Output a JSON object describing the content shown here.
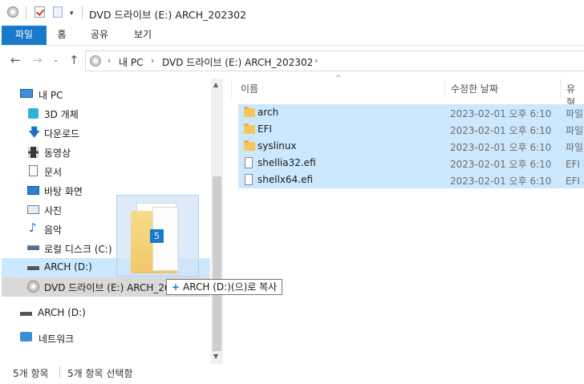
{
  "window": {
    "title": "DVD 드라이브 (E:) ARCH_202302"
  },
  "ribbon": {
    "tabs": [
      "파일",
      "홈",
      "공유",
      "보기"
    ]
  },
  "address": {
    "crumbs": [
      "내 PC",
      "DVD 드라이브 (E:) ARCH_202302"
    ]
  },
  "nav": {
    "items": [
      {
        "label": "내 PC",
        "icon": "computer-icon"
      },
      {
        "label": "3D 개체",
        "icon": "3d-objects-icon"
      },
      {
        "label": "다운로드",
        "icon": "download-arrow-icon"
      },
      {
        "label": "동영상",
        "icon": "film-icon"
      },
      {
        "label": "문서",
        "icon": "document-icon"
      },
      {
        "label": "바탕 화면",
        "icon": "desktop-icon"
      },
      {
        "label": "사진",
        "icon": "picture-icon"
      },
      {
        "label": "음악",
        "icon": "music-note-icon"
      },
      {
        "label": "로컬 디스크 (C:)",
        "icon": "local-disk-icon"
      },
      {
        "label": "ARCH (D:)",
        "icon": "drive-icon"
      },
      {
        "label": "DVD 드라이브 (E:) ARCH_202302",
        "icon": "dvd-icon"
      },
      {
        "label": "ARCH (D:)",
        "icon": "drive-icon"
      },
      {
        "label": "네트워크",
        "icon": "network-icon"
      }
    ]
  },
  "columns": {
    "name": "이름",
    "date": "수정한 날짜",
    "type": "유형"
  },
  "files": [
    {
      "name": "arch",
      "date": "2023-02-01 오후 6:10",
      "type": "파일 폴더",
      "kind": "folder"
    },
    {
      "name": "EFI",
      "date": "2023-02-01 오후 6:10",
      "type": "파일 폴더",
      "kind": "folder"
    },
    {
      "name": "syslinux",
      "date": "2023-02-01 오후 6:10",
      "type": "파일 폴더",
      "kind": "folder"
    },
    {
      "name": "shellia32.efi",
      "date": "2023-02-01 오후 6:10",
      "type": "EFI 파일",
      "kind": "file"
    },
    {
      "name": "shellx64.efi",
      "date": "2023-02-01 오후 6:10",
      "type": "EFI 파일",
      "kind": "file"
    }
  ],
  "drag": {
    "count": "5",
    "tooltip": "ARCH (D:)(으)로 복사"
  },
  "status": {
    "items": "5개 항목",
    "selected": "5개 항목 선택함"
  },
  "colors": {
    "accent": "#1979ca",
    "selection": "#cce8ff",
    "folder": "#f2c85b"
  }
}
